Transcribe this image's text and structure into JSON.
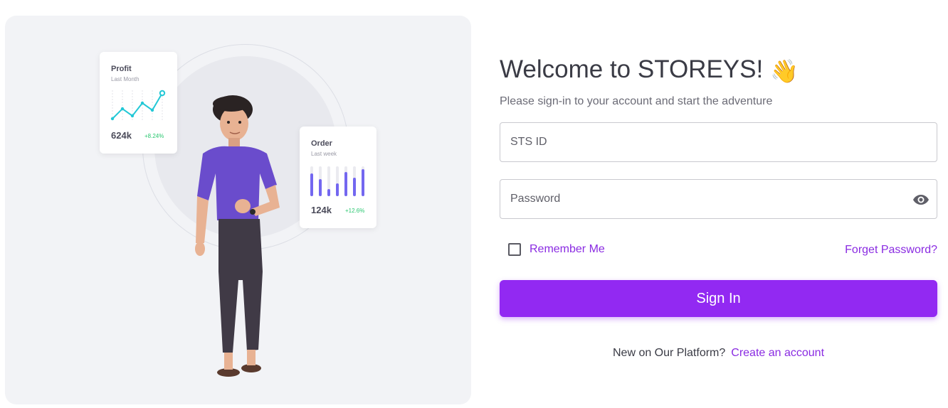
{
  "illustration": {
    "profit_card": {
      "title": "Profit",
      "subtitle": "Last Month",
      "value": "624k",
      "delta": "+8.24%"
    },
    "order_card": {
      "title": "Order",
      "subtitle": "Last week",
      "value": "124k",
      "delta": "+12.6%"
    }
  },
  "form": {
    "welcome_title": "Welcome to STOREYS!",
    "wave_emoji": "👋",
    "subtitle": "Please sign-in to your account and start the adventure",
    "id_placeholder": "STS ID",
    "password_placeholder": "Password",
    "remember_label": "Remember Me",
    "forgot_label": "Forget Password?",
    "signin_label": "Sign In",
    "signup_prompt": "New on Our Platform?",
    "signup_link": "Create an account"
  },
  "colors": {
    "accent": "#9229f2",
    "link": "#8a2be2",
    "positive": "#28c76f",
    "chart_line": "#23c8d6",
    "chart_bar": "#7367f0"
  }
}
